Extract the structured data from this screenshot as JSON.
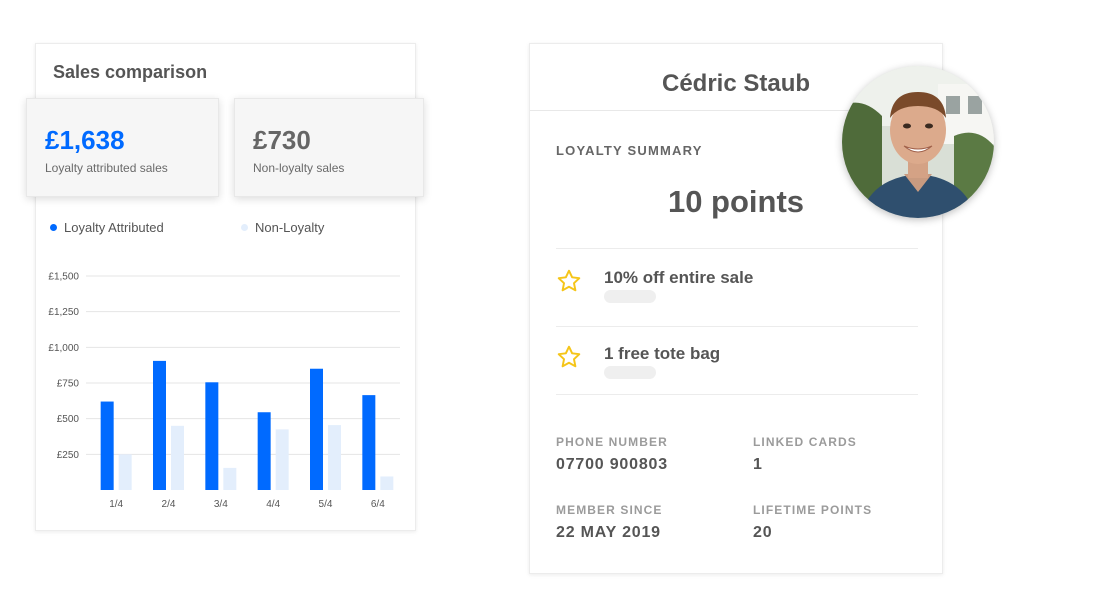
{
  "sales": {
    "title": "Sales comparison",
    "loyalty_value": "£1,638",
    "loyalty_label": "Loyalty attributed sales",
    "non_value": "£730",
    "non_label": "Non-loyalty sales",
    "legend_loyalty": "Loyalty Attributed",
    "legend_non": "Non-Loyalty"
  },
  "colors": {
    "accent": "#006aff",
    "light_series": "#e3eefc",
    "star": "#f5c518"
  },
  "chart_data": {
    "type": "bar",
    "categories": [
      "1/4",
      "2/4",
      "3/4",
      "4/4",
      "5/4",
      "6/4"
    ],
    "series": [
      {
        "name": "Loyalty Attributed",
        "values": [
          620,
          905,
          755,
          545,
          850,
          665
        ]
      },
      {
        "name": "Non-Loyalty",
        "values": [
          250,
          450,
          155,
          425,
          455,
          95
        ]
      }
    ],
    "yticks": [
      "£250",
      "£500",
      "£750",
      "£1,000",
      "£1,250",
      "£1,500"
    ],
    "ytick_values": [
      250,
      500,
      750,
      1000,
      1250,
      1500
    ],
    "ylim": [
      0,
      1500
    ],
    "grid": true,
    "legend_position": "top"
  },
  "profile": {
    "name": "Cédric Staub",
    "summary_heading": "LOYALTY SUMMARY",
    "points": "10 points",
    "rewards": [
      {
        "label": "10% off entire sale",
        "icon": "star-icon"
      },
      {
        "label": "1 free tote bag",
        "icon": "star-icon"
      }
    ],
    "phone_label": "PHONE NUMBER",
    "phone_value": "07700 900803",
    "cards_label": "LINKED CARDS",
    "cards_value": "1",
    "member_label": "MEMBER SINCE",
    "member_value": "22 MAY 2019",
    "lifetime_label": "LIFETIME POINTS",
    "lifetime_value": "20"
  }
}
